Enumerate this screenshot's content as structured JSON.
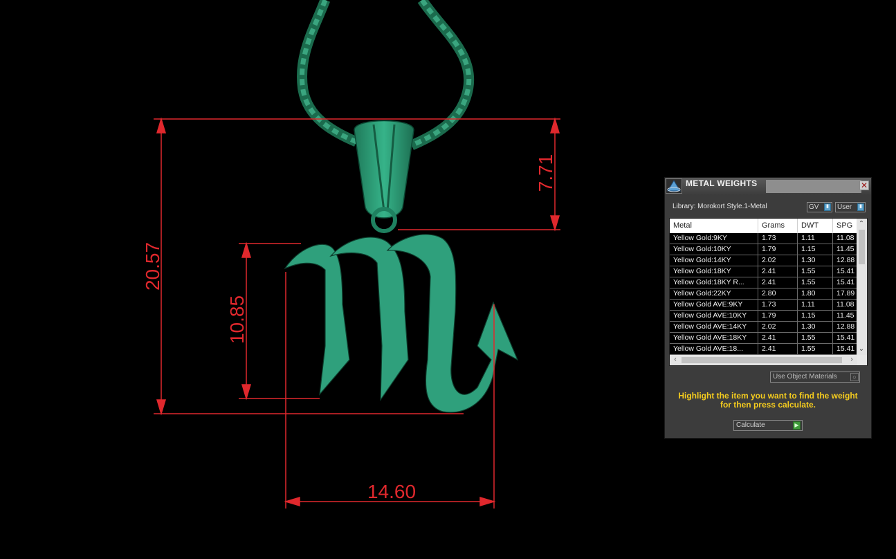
{
  "viewport": {
    "dimensions": {
      "height_total": "20.57",
      "bail_height": "7.71",
      "glyph_height": "10.85",
      "width": "14.60"
    }
  },
  "panel": {
    "title": "METAL WEIGHTS",
    "close_label": "✕",
    "library_label": "Library: Morokort Style.1-Metal",
    "toggles": {
      "gv": "GV",
      "user": "User"
    },
    "table": {
      "columns": [
        "Metal",
        "Grams",
        "DWT",
        "SPG"
      ],
      "rows": [
        [
          "Yellow Gold:9KY",
          "1.73",
          "1.11",
          "11.08"
        ],
        [
          "Yellow Gold:10KY",
          "1.79",
          "1.15",
          "11.45"
        ],
        [
          "Yellow Gold:14KY",
          "2.02",
          "1.30",
          "12.88"
        ],
        [
          "Yellow Gold:18KY",
          "2.41",
          "1.55",
          "15.41"
        ],
        [
          "Yellow Gold:18KY R...",
          "2.41",
          "1.55",
          "15.41"
        ],
        [
          "Yellow Gold:22KY",
          "2.80",
          "1.80",
          "17.89"
        ],
        [
          "Yellow Gold AVE:9KY",
          "1.73",
          "1.11",
          "11.08"
        ],
        [
          "Yellow Gold AVE:10KY",
          "1.79",
          "1.15",
          "11.45"
        ],
        [
          "Yellow Gold AVE:14KY",
          "2.02",
          "1.30",
          "12.88"
        ],
        [
          "Yellow Gold AVE:18KY",
          "2.41",
          "1.55",
          "15.41"
        ],
        [
          "Yellow Gold AVE:18...",
          "2.41",
          "1.55",
          "15.41"
        ]
      ]
    },
    "use_object_materials": "Use Object Materials",
    "instruction_line1": "Highlight the item you want to find the weight",
    "instruction_line2": "for then press calculate.",
    "calculate_label": "Calculate"
  },
  "colors": {
    "dimension": "#e0282d",
    "model": "#2fa07c",
    "instruction": "#f5cc1e"
  }
}
